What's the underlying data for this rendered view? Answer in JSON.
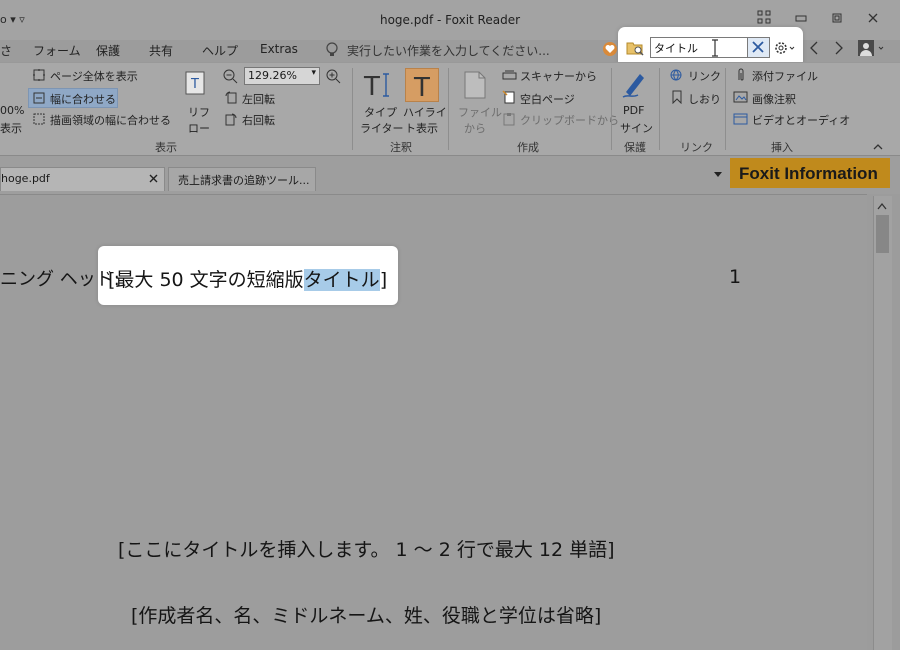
{
  "window": {
    "title": "hoge.pdf - Foxit Reader",
    "quick_access": "o ▾ ▿"
  },
  "menu": {
    "items": [
      "さ",
      "フォーム",
      "保護",
      "共有",
      "ヘルプ",
      "Extras"
    ],
    "tell_me": "実行したい作業を入力してください..."
  },
  "search": {
    "value": "タイトル"
  },
  "ribbon": {
    "view": {
      "zoom_pct_line1": "00%",
      "zoom_pct_line2": "表示",
      "full_page": "ページ全体を表示",
      "fit_width": "幅に合わせる",
      "fit_visible": "描画領域の幅に合わせる",
      "reflow_line1": "リフ",
      "reflow_line2": "ロー",
      "zoom_value": "129.26%",
      "rotate_left": "左回転",
      "rotate_right": "右回転",
      "group": "表示"
    },
    "comment": {
      "typewriter_line1": "タイプ",
      "typewriter_line2": "ライター",
      "highlight_line1": "ハイライ",
      "highlight_line2": "ト表示",
      "group": "注釈"
    },
    "create": {
      "from_file_line1": "ファイル",
      "from_file_line2": "から",
      "from_scanner": "スキャナーから",
      "blank_page": "空白ページ",
      "from_clipboard": "クリップボードから",
      "group": "作成"
    },
    "protect": {
      "pdf_sign_line1": "PDF",
      "pdf_sign_line2": "サイン",
      "group": "保護"
    },
    "link": {
      "link": "リンク",
      "bookmark": "しおり",
      "group": "リンク"
    },
    "insert": {
      "attachment": "添付ファイル",
      "image_annotation": "画像注釈",
      "video_audio": "ビデオとオーディオ",
      "group": "挿入"
    }
  },
  "tabs": [
    {
      "label": "hoge.pdf"
    },
    {
      "label": "売上請求書の追跡ツール..."
    }
  ],
  "foxit_info": "Foxit Information",
  "document": {
    "heading_prefix": "ニング ヘッド:",
    "heading_before": "[最大 50 文字の短縮版",
    "heading_match": "タイトル",
    "heading_after": "]",
    "page_number": "1",
    "title_placeholder": "[ここにタイトルを挿入します。 1 ～ 2 行で最大 12 単語]",
    "authors_placeholder": "[作成者名、名、ミドルネーム、姓、役職と学位は省略]"
  }
}
